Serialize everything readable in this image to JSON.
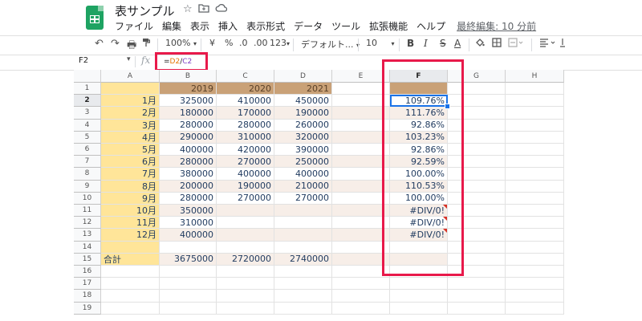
{
  "header": {
    "title": "表サンプル",
    "star_icon": "star-icon",
    "move_icon": "folder-icon",
    "cloud_icon": "cloud-icon"
  },
  "menu": {
    "items": [
      "ファイル",
      "編集",
      "表示",
      "挿入",
      "表示形式",
      "データ",
      "ツール",
      "拡張機能",
      "ヘルプ"
    ],
    "last_edit": "最終編集: 10 分前"
  },
  "toolbar": {
    "zoom": "100%",
    "currency": "¥",
    "percent": "%",
    "dec_decrease": ".0",
    "dec_increase": ".00",
    "more_formats": "123",
    "font": "デフォルト...",
    "font_size": "10",
    "bold": "B",
    "italic": "I",
    "strike": "S",
    "text_color": "A"
  },
  "formula_bar": {
    "cell_ref": "F2",
    "fx": "fx",
    "formula_eq": "=",
    "formula_ref1": "D2",
    "formula_div": "/",
    "formula_ref2": "C2",
    "ref1_color": "#e37400",
    "ref2_color": "#7e3fc4"
  },
  "sheet": {
    "columns": [
      "A",
      "B",
      "C",
      "D",
      "E",
      "F",
      "G",
      "H"
    ],
    "rows": [
      "1",
      "2",
      "3",
      "4",
      "5",
      "6",
      "7",
      "8",
      "9",
      "10",
      "11",
      "12",
      "13",
      "14",
      "15",
      "16",
      "17",
      "18",
      "19"
    ],
    "header_row": [
      "",
      "2019",
      "2020",
      "2021",
      "",
      ""
    ],
    "months": [
      "1月",
      "2月",
      "3月",
      "4月",
      "5月",
      "6月",
      "7月",
      "8月",
      "9月",
      "10月",
      "11月",
      "12月"
    ],
    "col_b": [
      "325000",
      "180000",
      "280000",
      "290000",
      "400000",
      "280000",
      "380000",
      "200000",
      "280000",
      "350000",
      "310000",
      "400000"
    ],
    "col_c": [
      "410000",
      "170000",
      "280000",
      "310000",
      "420000",
      "270000",
      "400000",
      "190000",
      "270000",
      "",
      "",
      ""
    ],
    "col_d": [
      "450000",
      "190000",
      "260000",
      "320000",
      "390000",
      "250000",
      "400000",
      "210000",
      "270000",
      "",
      "",
      ""
    ],
    "col_f": [
      "109.76%",
      "111.76%",
      "92.86%",
      "103.23%",
      "92.86%",
      "92.59%",
      "100.00%",
      "110.53%",
      "100.00%",
      "#DIV/0!",
      "#DIV/0!",
      "#DIV/0!"
    ],
    "total_label": "合計",
    "totals": [
      "3675000",
      "2720000",
      "2740000"
    ]
  },
  "colors": {
    "highlight": "#e8194a",
    "selection": "#1a73e8",
    "year_header": "#c9a177",
    "month_column": "#ffe599",
    "band": "#f7eee8"
  }
}
